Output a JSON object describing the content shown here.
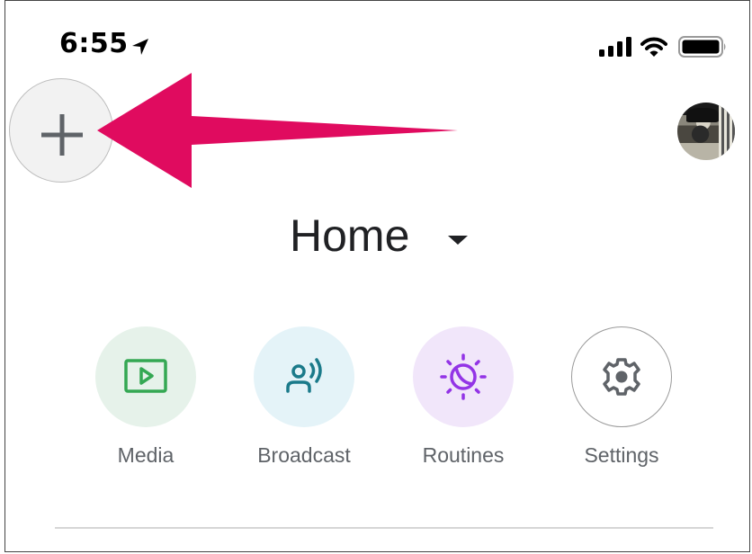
{
  "status_bar": {
    "time": "6:55",
    "icons": [
      "location-arrow-icon",
      "cellular-signal-icon",
      "wifi-icon",
      "battery-icon"
    ]
  },
  "header": {
    "add_button_icon": "plus-icon",
    "avatar_alt": "account-avatar",
    "annotation_color": "#E00B5F"
  },
  "home": {
    "title": "Home",
    "dropdown_icon": "caret-down-icon"
  },
  "actions": [
    {
      "label": "Media",
      "icon": "media-play-icon",
      "bg": "#E6F2EA",
      "fg": "#34A853"
    },
    {
      "label": "Broadcast",
      "icon": "broadcast-icon",
      "bg": "#E4F3F8",
      "fg": "#1A7A8A"
    },
    {
      "label": "Routines",
      "icon": "routines-icon",
      "bg": "#F1E6FA",
      "fg": "#9334E6"
    },
    {
      "label": "Settings",
      "icon": "gear-icon",
      "bg": "#FFFFFF",
      "fg": "#5F6368"
    }
  ]
}
